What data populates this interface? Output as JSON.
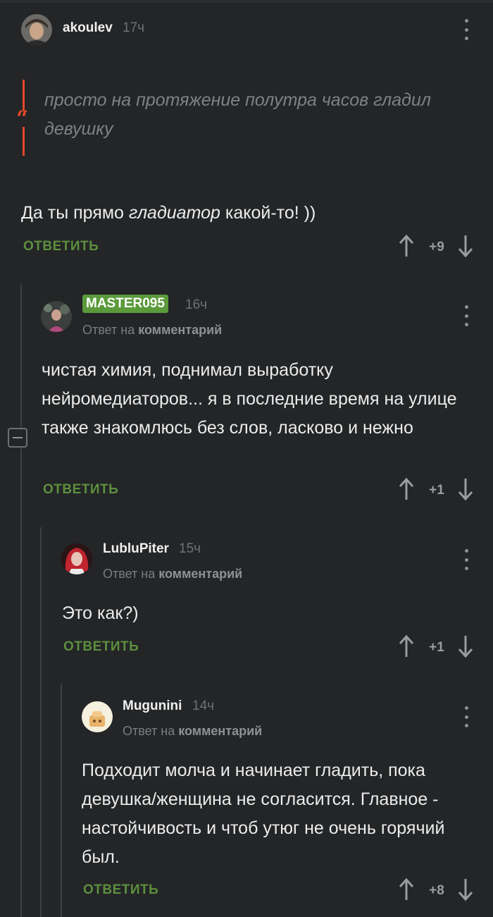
{
  "comments": [
    {
      "username": "akoulev",
      "time": "17ч",
      "quote": "просто на протяжение полутра часов гладил девушку",
      "text_before": "Да ты прямо ",
      "text_italic": "гладиатор",
      "text_after": " какой-то! ))",
      "reply_label": "ОТВЕТИТЬ",
      "rating": "+9"
    },
    {
      "username": "MASTER095",
      "time": "16ч",
      "reply_to_prefix": "Ответ на",
      "reply_to_target": "комментарий",
      "text": "чистая химия, поднимал выработку нейромедиаторов... я в последние время на улице также знакомлюсь без слов, ласково и нежно",
      "reply_label": "ОТВЕТИТЬ",
      "rating": "+1"
    },
    {
      "username": "LubluPiter",
      "time": "15ч",
      "reply_to_prefix": "Ответ на",
      "reply_to_target": "комментарий",
      "text": "Это как?)",
      "reply_label": "ОТВЕТИТЬ",
      "rating": "+1"
    },
    {
      "username": "Mugunini",
      "time": "14ч",
      "reply_to_prefix": "Ответ на",
      "reply_to_target": "комментарий",
      "text": "Подходит молча и начинает гладить, пока девушка/женщина не согласится. Главное - настойчивость и чтоб утюг не очень горячий был.",
      "reply_label": "ОТВЕТИТЬ",
      "rating": "+8"
    }
  ],
  "colors": {
    "background": "#232527",
    "accent_green": "#5d8f3d",
    "badge_green": "#5b9a3a",
    "quote_red": "#e2492a"
  }
}
